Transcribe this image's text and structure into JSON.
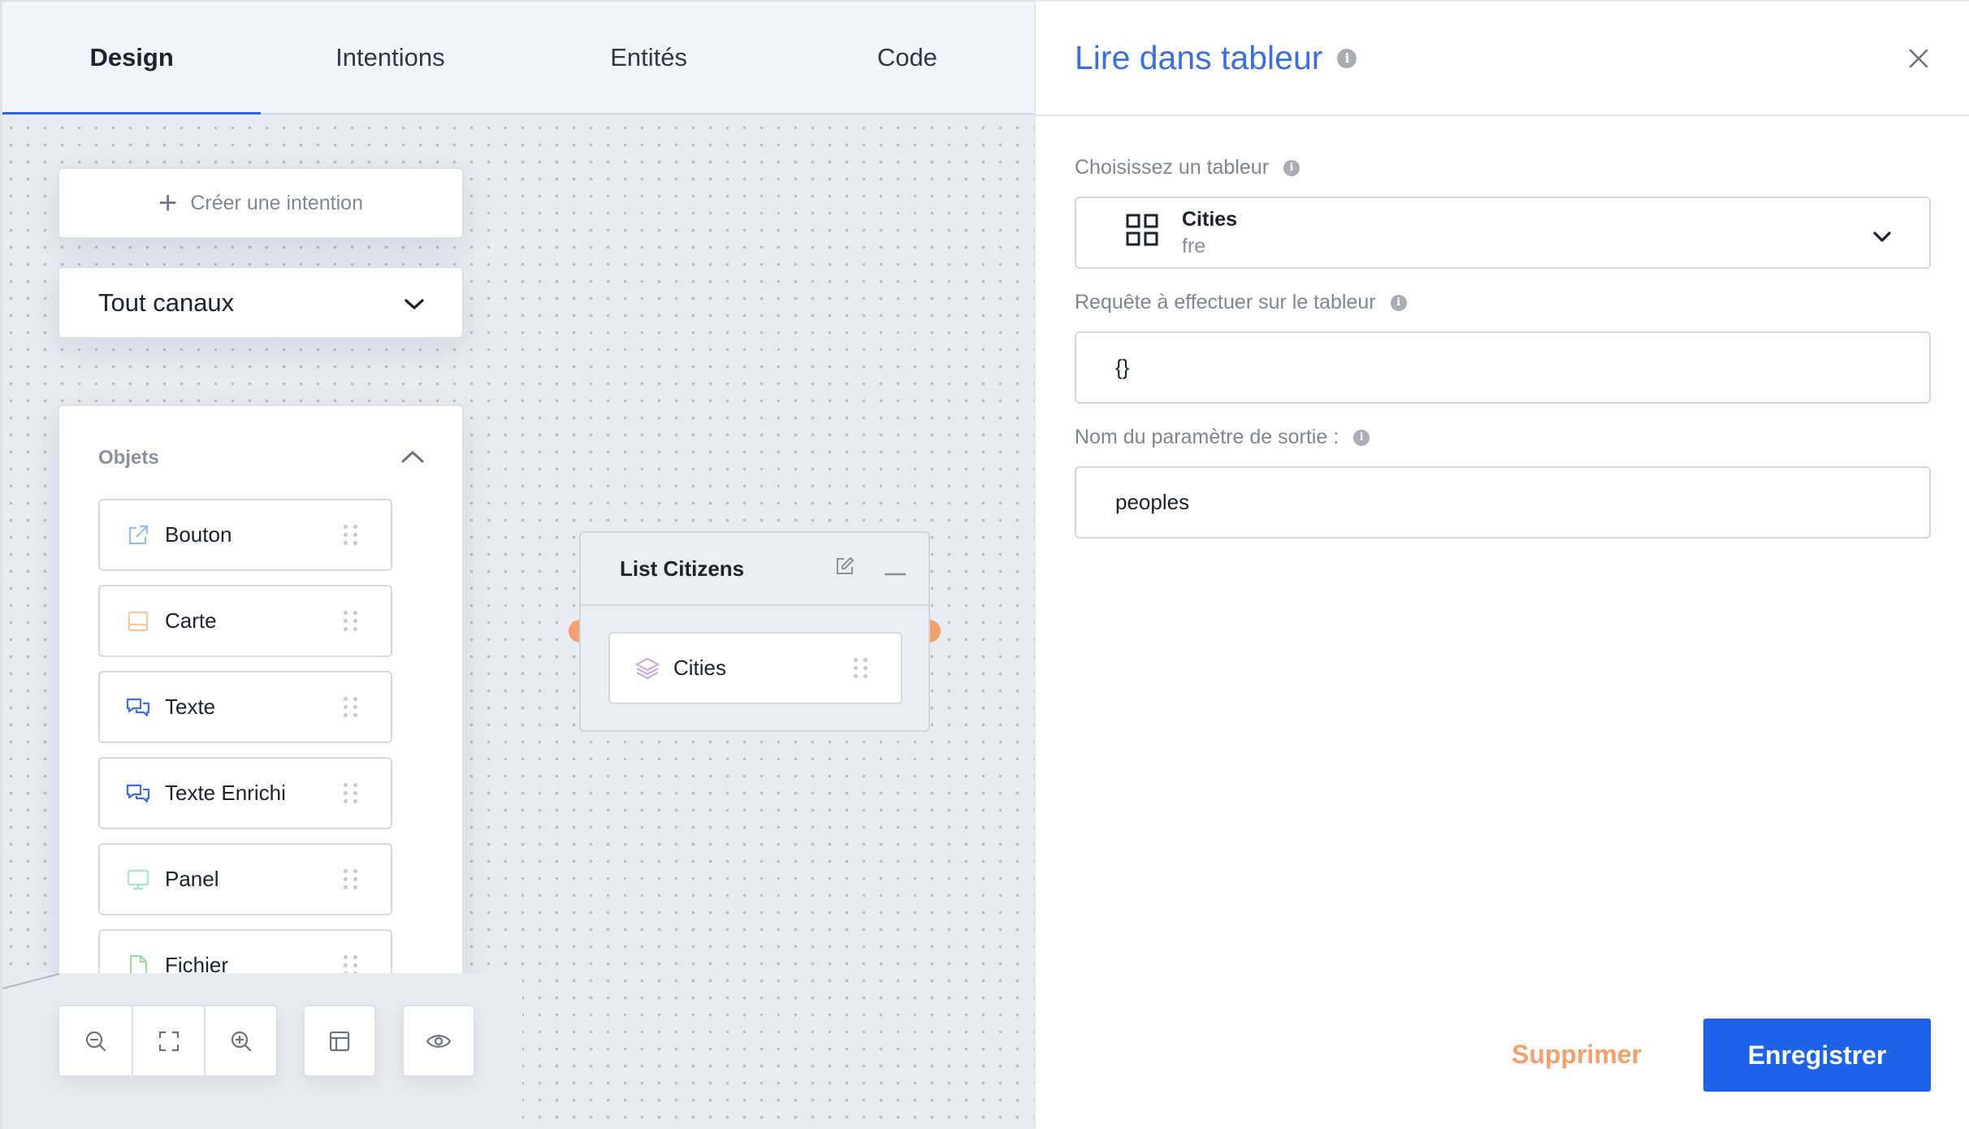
{
  "tabs": [
    {
      "label": "Design",
      "active": true
    },
    {
      "label": "Intentions",
      "active": false
    },
    {
      "label": "Entités",
      "active": false
    },
    {
      "label": "Code",
      "active": false
    }
  ],
  "sidebar": {
    "create_intent_label": "Créer une intention",
    "channel_select_value": "Tout canaux",
    "objects_title": "Objets",
    "objects": [
      {
        "label": "Bouton",
        "icon": "external-link-icon"
      },
      {
        "label": "Carte",
        "icon": "card-icon"
      },
      {
        "label": "Texte",
        "icon": "chat-bubbles-icon"
      },
      {
        "label": "Texte Enrichi",
        "icon": "chat-bubbles-icon"
      },
      {
        "label": "Panel",
        "icon": "monitor-icon"
      },
      {
        "label": "Fichier",
        "icon": "file-icon"
      }
    ]
  },
  "toolbar": {
    "buttons": [
      "zoom-out-icon",
      "fit-screen-icon",
      "zoom-in-icon",
      "layout-icon",
      "preview-eye-icon"
    ]
  },
  "node": {
    "title": "List Citizens",
    "item_label": "Cities"
  },
  "panel": {
    "title": "Lire dans tableur",
    "sheet_label": "Choisissez un tableur",
    "sheet_value_title": "Cities",
    "sheet_value_sub": "fre",
    "query_label": "Requête à effectuer sur le tableur",
    "query_value": "{}",
    "output_label": "Nom du paramètre de sortie :",
    "output_value": "peoples",
    "delete_label": "Supprimer",
    "save_label": "Enregistrer"
  },
  "colors": {
    "accent": "#1e62e8",
    "title": "#3b6fe0",
    "danger": "#f2a06c",
    "port": "#f3a26e"
  }
}
